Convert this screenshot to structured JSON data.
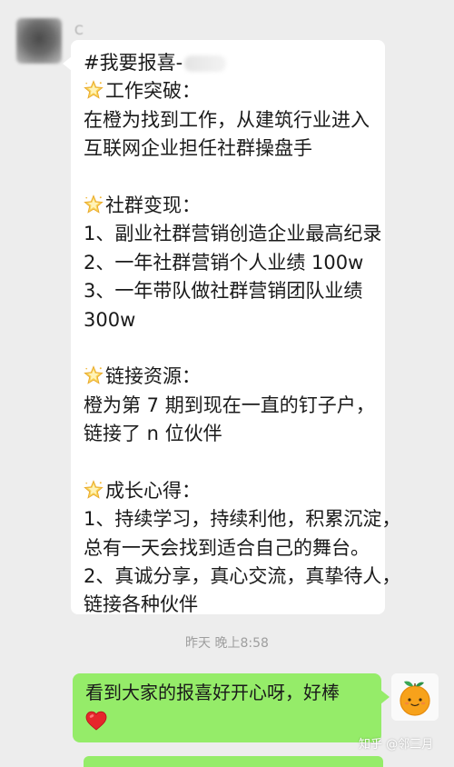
{
  "incoming": {
    "sender_name": "C",
    "message": {
      "tag_line": "#我要报喜-",
      "sections": [
        {
          "icon": "sparkle-star-icon",
          "heading": "工作突破：",
          "lines": [
            "在橙为找到工作，从建筑行业进入",
            "互联网企业担任社群操盘手"
          ]
        },
        {
          "icon": "sparkle-star-icon",
          "heading": "社群变现：",
          "lines": [
            "1、副业社群营销创造企业最高纪录",
            "2、一年社群营销个人业绩 100w",
            "3、一年带队做社群营销团队业绩",
            "300w"
          ]
        },
        {
          "icon": "sparkle-star-icon",
          "heading": "链接资源：",
          "lines": [
            "橙为第 7 期到现在一直的钉子户，",
            "链接了 n 位伙伴"
          ]
        },
        {
          "icon": "sparkle-star-icon",
          "heading": "成长心得：",
          "lines": [
            "1、持续学习，持续利他，积累沉淀，",
            "总有一天会找到适合自己的舞台。",
            "2、真诚分享，真心交流，真挚待人，",
            "链接各种伙伴"
          ]
        }
      ]
    }
  },
  "timestamp": "昨天 晚上8:58",
  "outgoing": {
    "text": "看到大家的报喜好开心呀，好棒",
    "emoji": "heart-icon"
  },
  "watermark": "知乎 @邻三月",
  "colors": {
    "background": "#ededed",
    "incoming_bubble": "#ffffff",
    "outgoing_bubble": "#95ec69",
    "star": "#f6c343",
    "heart": "#e5262b"
  }
}
